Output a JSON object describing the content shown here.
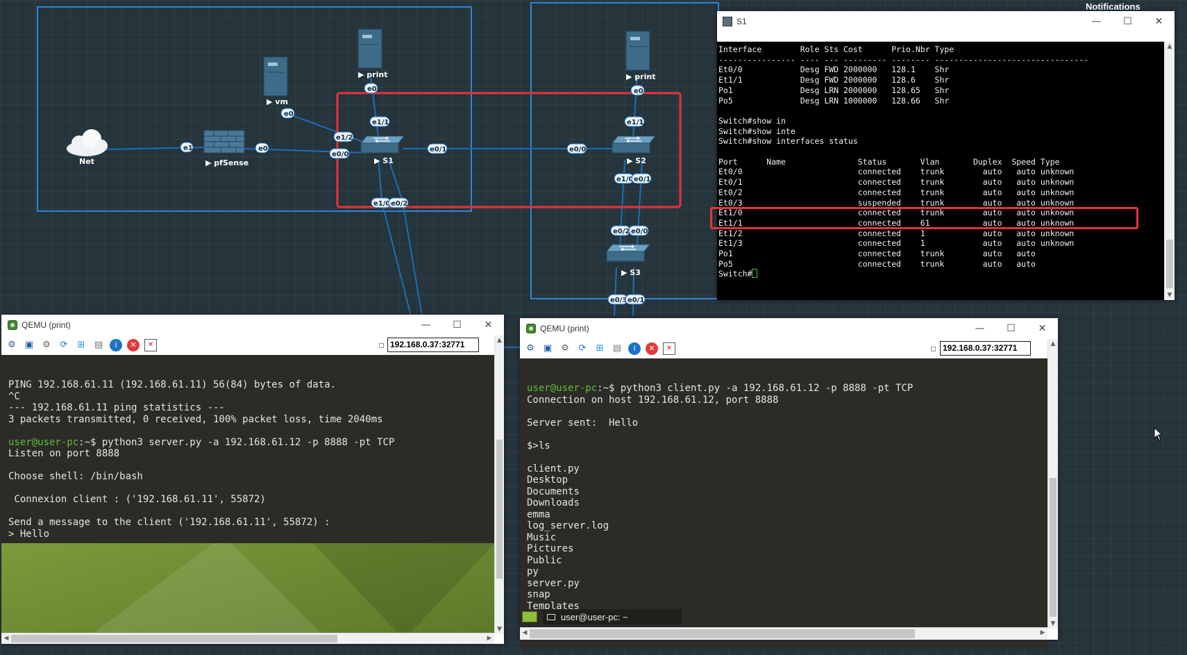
{
  "notifications_label": "Notifications",
  "topology": {
    "nodes": {
      "net": "Net",
      "pfsense": "pfSense",
      "vm": "vm",
      "print_left": "print",
      "print_right": "print",
      "s1": "S1",
      "s2": "S2",
      "s3": "S3"
    },
    "ports": {
      "net_e1": "e1",
      "pf_e0": "e0",
      "vm_e0": "e0",
      "print1_e0": "e0",
      "s1_e1_1": "e1/1",
      "s1_e1_2": "e1/2",
      "s1_e0_0": "e0/0",
      "s1_e0_1": "e0/1",
      "s1_e1_0": "e1/0",
      "s1_e0_2": "e0/2",
      "s2_e0_0": "e0/0",
      "print2_e0": "e0",
      "s2_e1_1": "e1/1",
      "s2_e1_0": "e1/0",
      "s2_e0_1": "e0/1",
      "s3_e0_2": "e0/2",
      "s3_e0_0": "e0/0",
      "s3_e0_3": "e0/3",
      "s3_e0_1": "e0/1"
    }
  },
  "s1_console": {
    "title": "S1",
    "lines": [
      "Interface        Role Sts Cost      Prio.Nbr Type",
      "---------------- ---- --- --------- -------- --------------------------------",
      "Et0/0            Desg FWD 2000000   128.1    Shr",
      "Et1/1            Desg FWD 2000000   128.6    Shr",
      "Po1              Desg LRN 2000000   128.65   Shr",
      "Po5              Desg LRN 1000000   128.66   Shr",
      "",
      "Switch#show in",
      "Switch#show inte",
      "Switch#show interfaces status",
      "",
      "Port      Name               Status       Vlan       Duplex  Speed Type",
      "Et0/0                        connected    trunk        auto   auto unknown",
      "Et0/1                        connected    trunk        auto   auto unknown",
      "Et0/2                        connected    trunk        auto   auto unknown",
      "Et0/3                        suspended    trunk        auto   auto unknown",
      "Et1/0                        connected    trunk        auto   auto unknown",
      "Et1/1                        connected    61           auto   auto unknown",
      "Et1/2                        connected    1            auto   auto unknown",
      "Et1/3                        connected    1            auto   auto unknown",
      "Po1                          connected    trunk        auto   auto",
      "Po5                          connected    trunk        auto   auto"
    ],
    "prompt": "Switch#"
  },
  "qemu_left": {
    "title": "QEMU (print)",
    "address": "192.168.0.37:32771",
    "lines": [
      {
        "t": "PING 192.168.61.11 (192.168.61.11) 56(84) bytes of data."
      },
      {
        "t": "^C"
      },
      {
        "t": "--- 192.168.61.11 ping statistics ---"
      },
      {
        "t": "3 packets transmitted, 0 received, 100% packet loss, time 2040ms"
      },
      {
        "t": ""
      },
      {
        "p": "user@user-pc",
        "t": ":~$ python3 server.py -a 192.168.61.12 -p 8888 -pt TCP"
      },
      {
        "t": "Listen on port 8888"
      },
      {
        "t": ""
      },
      {
        "t": "Choose shell: /bin/bash"
      },
      {
        "t": ""
      },
      {
        "t": " Connexion client : ('192.168.61.11', 55872)"
      },
      {
        "t": ""
      },
      {
        "t": "Send a message to the client ('192.168.61.11', 55872) :"
      },
      {
        "t": "> Hello"
      }
    ]
  },
  "qemu_right": {
    "title": "QEMU (print)",
    "address": "192.168.0.37:32771",
    "lines": [
      {
        "p": "user@user-pc",
        "t": ":~$ python3 client.py -a 192.168.61.12 -p 8888 -pt TCP"
      },
      {
        "t": "Connection on host 192.168.61.12, port 8888"
      },
      {
        "t": ""
      },
      {
        "t": "Server sent:  Hello"
      },
      {
        "t": ""
      },
      {
        "t": "$>ls"
      },
      {
        "t": ""
      },
      {
        "t": "client.py"
      },
      {
        "t": "Desktop"
      },
      {
        "t": "Documents"
      },
      {
        "t": "Downloads"
      },
      {
        "t": "emma"
      },
      {
        "t": "log_server.log"
      },
      {
        "t": "Music"
      },
      {
        "t": "Pictures"
      },
      {
        "t": "Public"
      },
      {
        "t": "py"
      },
      {
        "t": "server.py"
      },
      {
        "t": "snap"
      },
      {
        "t": "Templates"
      }
    ],
    "taskbar_label": "user@user-pc: ~"
  },
  "colors": {
    "canvas_bg": "#26343c",
    "link": "#1b6fb8",
    "group_border": "#2d86d9",
    "highlight": "#e8323a",
    "prompt_green": "#5fbe3c",
    "terminal_bg": "#2c2b26"
  },
  "icons": [
    "cloud-icon",
    "firewall-icon",
    "server-icon",
    "switch-icon",
    "qemu-app-icon",
    "terminal-app-icon",
    "minimize-icon",
    "maximize-icon",
    "close-icon"
  ]
}
